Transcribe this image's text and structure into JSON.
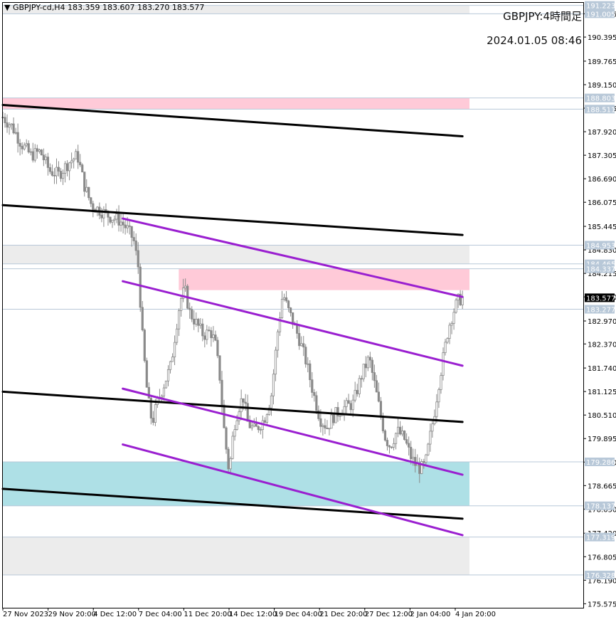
{
  "window": {
    "symbol_line": "▼ GBPJPY-cd,H4  183.359 183.607 183.270 183.577",
    "caption_title": "GBPJPY:4時間足",
    "caption_datetime": "2024.01.05 08:46"
  },
  "chart_data": {
    "type": "candlestick",
    "symbol": "GBPJPY-cd",
    "timeframe": "H4",
    "ohlc_header": {
      "open": 183.359,
      "high": 183.607,
      "low": 183.27,
      "close": 183.577
    },
    "current_price": 183.577,
    "ylim": [
      175.47,
      191.29
    ],
    "y_ticks": [
      191.005,
      190.395,
      189.765,
      189.15,
      188.535,
      187.92,
      187.305,
      186.69,
      186.075,
      185.445,
      184.83,
      184.215,
      183.6,
      182.97,
      182.37,
      181.74,
      181.125,
      180.51,
      179.895,
      179.28,
      178.665,
      178.05,
      177.42,
      176.805,
      176.19,
      175.575
    ],
    "x_ticks": [
      "27 Nov 2023",
      "29 Nov 20:00",
      "4 Dec 12:00",
      "7 Dec 04:00",
      "11 Dec 20:00",
      "14 Dec 12:00",
      "19 Dec 04:00",
      "21 Dec 20:00",
      "27 Dec 12:00",
      "2 Jan 04:00",
      "4 Jan 20:00"
    ],
    "level_labels": [
      191.223,
      191.005,
      188.803,
      188.511,
      184.953,
      184.465,
      184.337,
      183.277,
      179.286,
      178.137,
      177.319,
      176.328
    ],
    "zones": [
      {
        "top": 191.223,
        "bottom": 191.005,
        "color": "#ececec",
        "start": 0
      },
      {
        "top": 188.803,
        "bottom": 188.511,
        "color": "#ffcad8",
        "start": 0
      },
      {
        "top": 184.953,
        "bottom": 184.465,
        "color": "#ececec",
        "start": 0
      },
      {
        "top": 184.337,
        "bottom": 183.777,
        "color": "#ffcad8",
        "start": 0.377
      },
      {
        "top": 179.286,
        "bottom": 178.137,
        "color": "#aee0e6",
        "start": 0
      },
      {
        "top": 177.319,
        "bottom": 176.328,
        "color": "#ececec",
        "start": 0
      }
    ],
    "trend_lines": [
      {
        "color": "#000000",
        "from": [
          0.0,
          188.62
        ],
        "to": [
          0.985,
          187.8
        ]
      },
      {
        "color": "#000000",
        "from": [
          0.0,
          186.0
        ],
        "to": [
          0.985,
          185.22
        ]
      },
      {
        "color": "#000000",
        "from": [
          0.0,
          181.12
        ],
        "to": [
          0.985,
          180.33
        ]
      },
      {
        "color": "#000000",
        "from": [
          0.0,
          178.58
        ],
        "to": [
          0.985,
          177.8
        ]
      },
      {
        "color": "#9a1fd0",
        "from": [
          0.257,
          185.65
        ],
        "to": [
          0.985,
          183.6
        ]
      },
      {
        "color": "#9a1fd0",
        "from": [
          0.257,
          184.01
        ],
        "to": [
          0.985,
          181.8
        ]
      },
      {
        "color": "#9a1fd0",
        "from": [
          0.257,
          181.2
        ],
        "to": [
          0.985,
          178.95
        ]
      },
      {
        "color": "#9a1fd0",
        "from": [
          0.257,
          179.74
        ],
        "to": [
          0.985,
          177.37
        ]
      }
    ],
    "close_path": [
      [
        0.0,
        188.3
      ],
      [
        0.02,
        188.05
      ],
      [
        0.04,
        187.6
      ],
      [
        0.06,
        187.3
      ],
      [
        0.08,
        187.4
      ],
      [
        0.1,
        186.9
      ],
      [
        0.12,
        186.8
      ],
      [
        0.14,
        187.1
      ],
      [
        0.16,
        187.3
      ],
      [
        0.175,
        186.5
      ],
      [
        0.19,
        186.0
      ],
      [
        0.21,
        185.85
      ],
      [
        0.23,
        185.7
      ],
      [
        0.25,
        185.6
      ],
      [
        0.265,
        185.4
      ],
      [
        0.28,
        185.1
      ],
      [
        0.29,
        184.4
      ],
      [
        0.3,
        182.4
      ],
      [
        0.31,
        181.0
      ],
      [
        0.32,
        180.3
      ],
      [
        0.33,
        180.8
      ],
      [
        0.345,
        181.3
      ],
      [
        0.36,
        181.8
      ],
      [
        0.37,
        182.7
      ],
      [
        0.38,
        183.5
      ],
      [
        0.39,
        183.8
      ],
      [
        0.4,
        183.2
      ],
      [
        0.415,
        182.9
      ],
      [
        0.43,
        182.6
      ],
      [
        0.445,
        182.7
      ],
      [
        0.455,
        182.4
      ],
      [
        0.465,
        181.5
      ],
      [
        0.475,
        180.0
      ],
      [
        0.485,
        179.0
      ],
      [
        0.495,
        180.2
      ],
      [
        0.505,
        180.7
      ],
      [
        0.515,
        181.0
      ],
      [
        0.525,
        180.3
      ],
      [
        0.54,
        180.1
      ],
      [
        0.56,
        180.4
      ],
      [
        0.575,
        181.0
      ],
      [
        0.59,
        182.8
      ],
      [
        0.6,
        183.7
      ],
      [
        0.61,
        183.3
      ],
      [
        0.62,
        183.0
      ],
      [
        0.635,
        182.5
      ],
      [
        0.65,
        181.9
      ],
      [
        0.665,
        181.1
      ],
      [
        0.68,
        180.4
      ],
      [
        0.695,
        180.2
      ],
      [
        0.71,
        180.5
      ],
      [
        0.73,
        180.7
      ],
      [
        0.75,
        180.8
      ],
      [
        0.77,
        181.6
      ],
      [
        0.785,
        182.0
      ],
      [
        0.795,
        181.4
      ],
      [
        0.81,
        180.5
      ],
      [
        0.82,
        179.9
      ],
      [
        0.83,
        179.7
      ],
      [
        0.845,
        180.1
      ],
      [
        0.86,
        179.9
      ],
      [
        0.875,
        179.4
      ],
      [
        0.885,
        179.2
      ],
      [
        0.895,
        179.1
      ],
      [
        0.905,
        179.2
      ],
      [
        0.915,
        179.9
      ],
      [
        0.925,
        180.6
      ],
      [
        0.935,
        181.4
      ],
      [
        0.945,
        182.1
      ],
      [
        0.955,
        182.8
      ],
      [
        0.965,
        183.2
      ],
      [
        0.975,
        183.5
      ],
      [
        0.985,
        183.577
      ]
    ]
  }
}
